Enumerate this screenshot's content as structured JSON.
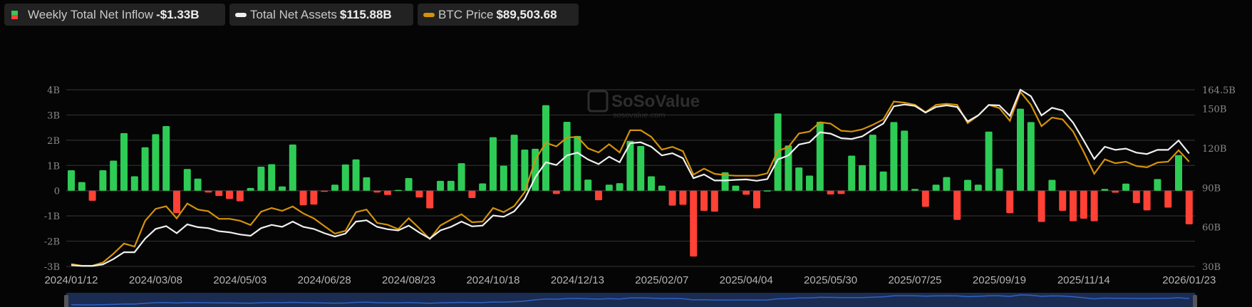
{
  "legend": {
    "inflow": {
      "label": "Weekly Total Net Inflow",
      "value": "-$1.33B",
      "colors": [
        "#2ecc55",
        "#ff4136"
      ]
    },
    "assets": {
      "label": "Total Net Assets",
      "value": "$115.88B",
      "color": "#f0f0f0"
    },
    "btc": {
      "label": "BTC Price",
      "value": "$89,503.68",
      "color": "#d4920a"
    }
  },
  "watermark": {
    "name": "SoSoValue",
    "url": "sosovalue.com"
  },
  "chart_data": {
    "type": "bar+line",
    "grid": true,
    "left_axis": {
      "ticks": [
        "4B",
        "3B",
        "2B",
        "1B",
        "0",
        "-1B",
        "-2B",
        "-3B"
      ],
      "tick_values": [
        4,
        3,
        2,
        1,
        0,
        -1,
        -2,
        -3
      ],
      "range": [
        -3,
        4
      ],
      "unit": "B USD"
    },
    "right_axis": {
      "ticks": [
        "164.5B",
        "150B",
        "120B",
        "90B",
        "60B",
        "30B"
      ],
      "tick_values": [
        164.5,
        150,
        120,
        90,
        60,
        30
      ],
      "range": [
        30,
        164.5
      ],
      "unit": "B USD"
    },
    "btc_axis_range": [
      40900,
      122900
    ],
    "x_ticks": [
      "2024/01/12",
      "2024/03/08",
      "2024/05/03",
      "2024/06/28",
      "2024/08/23",
      "2024/10/18",
      "2024/12/13",
      "2025/02/07",
      "2025/04/04",
      "2025/05/30",
      "2025/07/25",
      "2025/09/19",
      "2025/11/14",
      "2026/01/23"
    ],
    "x": [
      "2024/01/12",
      "2024/01/19",
      "2024/01/26",
      "2024/02/02",
      "2024/02/09",
      "2024/02/16",
      "2024/02/23",
      "2024/03/01",
      "2024/03/08",
      "2024/03/15",
      "2024/03/22",
      "2024/03/29",
      "2024/04/05",
      "2024/04/12",
      "2024/04/19",
      "2024/04/26",
      "2024/05/03",
      "2024/05/10",
      "2024/05/17",
      "2024/05/24",
      "2024/05/31",
      "2024/06/07",
      "2024/06/14",
      "2024/06/21",
      "2024/06/28",
      "2024/07/05",
      "2024/07/12",
      "2024/07/19",
      "2024/07/26",
      "2024/08/02",
      "2024/08/09",
      "2024/08/16",
      "2024/08/23",
      "2024/08/30",
      "2024/09/06",
      "2024/09/13",
      "2024/09/20",
      "2024/09/27",
      "2024/10/04",
      "2024/10/11",
      "2024/10/18",
      "2024/10/25",
      "2024/11/01",
      "2024/11/08",
      "2024/11/15",
      "2024/11/22",
      "2024/11/29",
      "2024/12/06",
      "2024/12/13",
      "2024/12/20",
      "2024/12/27",
      "2025/01/03",
      "2025/01/10",
      "2025/01/17",
      "2025/01/24",
      "2025/01/31",
      "2025/02/07",
      "2025/02/14",
      "2025/02/21",
      "2025/02/28",
      "2025/03/07",
      "2025/03/14",
      "2025/03/21",
      "2025/03/28",
      "2025/04/04",
      "2025/04/11",
      "2025/04/18",
      "2025/04/25",
      "2025/05/02",
      "2025/05/09",
      "2025/05/16",
      "2025/05/23",
      "2025/05/30",
      "2025/06/06",
      "2025/06/13",
      "2025/06/20",
      "2025/06/27",
      "2025/07/04",
      "2025/07/11",
      "2025/07/18",
      "2025/07/25",
      "2025/08/01",
      "2025/08/08",
      "2025/08/15",
      "2025/08/22",
      "2025/08/29",
      "2025/09/05",
      "2025/09/12",
      "2025/09/19",
      "2025/09/26",
      "2025/10/03",
      "2025/10/10",
      "2025/10/17",
      "2025/10/24",
      "2025/10/31",
      "2025/11/07",
      "2025/11/14",
      "2025/11/21",
      "2025/11/28",
      "2025/12/05",
      "2025/12/12",
      "2025/12/19",
      "2025/12/26",
      "2026/01/02",
      "2026/01/09",
      "2026/01/16",
      "2026/01/23"
    ],
    "series": [
      {
        "name": "Weekly Total Net Inflow",
        "type": "bar",
        "axis": "left",
        "positive_color": "#2ecc55",
        "negative_color": "#ff4136",
        "values": [
          0.81,
          0.34,
          -0.4,
          0.81,
          1.19,
          2.28,
          0.57,
          1.72,
          2.24,
          2.56,
          -0.89,
          0.86,
          0.48,
          -0.07,
          -0.21,
          -0.33,
          -0.42,
          0.11,
          0.95,
          1.05,
          0.17,
          1.83,
          -0.58,
          -0.55,
          -0.04,
          0.24,
          1.04,
          1.24,
          0.53,
          -0.07,
          -0.17,
          0.03,
          0.5,
          -0.27,
          -0.7,
          0.39,
          0.39,
          1.09,
          -0.29,
          0.29,
          2.12,
          0.99,
          2.22,
          1.63,
          1.66,
          3.39,
          -0.13,
          2.73,
          2.17,
          0.44,
          -0.38,
          0.24,
          0.3,
          1.97,
          1.77,
          0.57,
          0.2,
          -0.59,
          -0.56,
          -2.61,
          -0.8,
          -0.83,
          0.73,
          0.2,
          -0.16,
          -0.7,
          0.01,
          3.06,
          1.79,
          0.92,
          0.6,
          2.73,
          -0.15,
          -0.13,
          1.39,
          1.01,
          2.22,
          0.76,
          2.72,
          2.38,
          0.07,
          -0.64,
          0.24,
          0.54,
          -1.16,
          0.43,
          0.24,
          2.34,
          0.88,
          -0.89,
          3.25,
          2.72,
          -1.24,
          0.43,
          -0.8,
          -1.21,
          -1.11,
          -1.21,
          0.07,
          -0.08,
          0.28,
          -0.49,
          -0.78,
          0.46,
          -0.67,
          1.41,
          -1.33
        ]
      },
      {
        "name": "Total Net Assets",
        "type": "line",
        "axis": "right",
        "color": "#f0f0f0",
        "values": [
          30.9,
          30.4,
          30.3,
          31.5,
          35.6,
          40.8,
          40.8,
          51.1,
          58.5,
          60.7,
          55.3,
          62.0,
          59.9,
          59.1,
          56.8,
          56.0,
          54.3,
          53.3,
          59.1,
          61.6,
          60.1,
          64.1,
          60.1,
          58.5,
          55.3,
          52.7,
          55.0,
          64.1,
          65.1,
          60.1,
          58.3,
          57.4,
          61.1,
          55.8,
          51.2,
          57.4,
          60.1,
          64.1,
          60.5,
          61.1,
          68.8,
          67.8,
          71.9,
          81.3,
          97.9,
          109.3,
          107.2,
          114.5,
          116.6,
          111.4,
          107.9,
          113.5,
          109.3,
          123.8,
          124.5,
          121.1,
          114.5,
          116.2,
          112.4,
          97.2,
          100.0,
          95.4,
          95.4,
          95.9,
          96.2,
          95.2,
          96.5,
          111.4,
          114.5,
          122.8,
          124.5,
          132.1,
          131.1,
          127.6,
          127.0,
          129.0,
          134.2,
          138.8,
          151.9,
          153.3,
          152.2,
          147.1,
          151.4,
          152.6,
          151.4,
          140.4,
          145.0,
          152.9,
          152.6,
          144.6,
          164.5,
          159.5,
          145.0,
          150.8,
          148.7,
          139.4,
          125.9,
          111.8,
          121.1,
          118.7,
          119.7,
          116.6,
          115.6,
          118.7,
          118.7,
          125.9,
          115.88
        ]
      },
      {
        "name": "BTC Price",
        "type": "line",
        "axis": "btc",
        "color": "#d4920a",
        "values": [
          42000,
          41200,
          41200,
          42700,
          46800,
          51500,
          50100,
          62000,
          67600,
          68800,
          63200,
          70100,
          67300,
          66500,
          63000,
          63000,
          62100,
          60100,
          66300,
          68000,
          66700,
          68700,
          65500,
          63200,
          59600,
          56100,
          57400,
          66100,
          67300,
          61100,
          60200,
          58200,
          63300,
          58600,
          53600,
          59900,
          62600,
          65100,
          61400,
          61700,
          68000,
          66100,
          68900,
          75400,
          90400,
          98300,
          96600,
          100700,
          101000,
          95700,
          93800,
          97600,
          93800,
          104100,
          104100,
          101000,
          95100,
          96400,
          94400,
          83500,
          86300,
          83900,
          83300,
          83000,
          83000,
          83000,
          84100,
          94500,
          96300,
          102600,
          103500,
          107800,
          107200,
          103900,
          103500,
          104500,
          106600,
          109100,
          117400,
          116900,
          115900,
          112500,
          115900,
          116400,
          115900,
          107400,
          111000,
          115900,
          114400,
          108500,
          121900,
          115900,
          106000,
          110000,
          109100,
          103500,
          94100,
          83900,
          90600,
          88800,
          89500,
          87500,
          86900,
          89100,
          89500,
          94800,
          89503.68
        ]
      }
    ]
  }
}
